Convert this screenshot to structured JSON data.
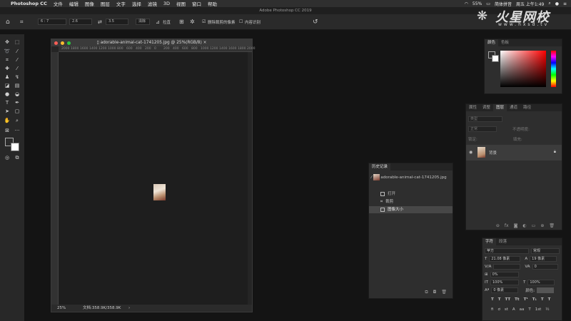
{
  "menubar": {
    "apple": "",
    "app": "Photoshop CC",
    "items": [
      "文件",
      "编辑",
      "图像",
      "图层",
      "文字",
      "选择",
      "滤镜",
      "3D",
      "视图",
      "窗口",
      "帮助"
    ],
    "battery": "55%",
    "input_method": "简体拼音",
    "clock": "周五 上午1:49"
  },
  "app_title": "Adobe Photoshop CC 2019",
  "options": {
    "ratio_w": "6 : 7",
    "ratio_h": "2.6",
    "value3": "3.5",
    "clear": "清除",
    "straighten": "拉直",
    "delete_cropped": "删除裁剪的像素",
    "content_aware": "内容识别"
  },
  "document": {
    "title": "adorable-animal-cat-1741205.jpg @ 25%(RGB/8)",
    "ruler_ticks": [
      "2000",
      "1800",
      "1600",
      "1400",
      "1200",
      "1000",
      "800",
      "600",
      "400",
      "200",
      "0",
      "200",
      "400",
      "600",
      "800",
      "1000",
      "1200",
      "1400",
      "1600",
      "1800",
      "2000"
    ],
    "zoom": "25%",
    "doc_size": "文档:358.9K/358.9K"
  },
  "color_panel": {
    "tabs": [
      "颜色",
      "色板"
    ]
  },
  "layers_panel": {
    "tabs": [
      "属性",
      "调整",
      "图层",
      "通道",
      "路径"
    ],
    "kind": "类型",
    "blend": "正常",
    "opacity_label": "不透明度:",
    "lock_label": "锁定:",
    "fill_label": "填充:",
    "layer_name": "背景"
  },
  "history_panel": {
    "title": "历史记录",
    "snapshot": "adorable-animal-cat-1741205.jpg",
    "steps": [
      "打开",
      "裁剪",
      "图像大小"
    ]
  },
  "char_panel": {
    "tabs": [
      "字符",
      "段落"
    ],
    "font": "苹方",
    "style": "常规",
    "size": "21.08 像素",
    "leading": "19 像素",
    "tracking": "0",
    "vscale": "0%",
    "hscale": "100%",
    "vscale2": "100%",
    "baseline": "0 像素",
    "color_label": "颜色:"
  },
  "watermark": {
    "brand": "火星网校",
    "url": "www.hxsd.tv"
  }
}
